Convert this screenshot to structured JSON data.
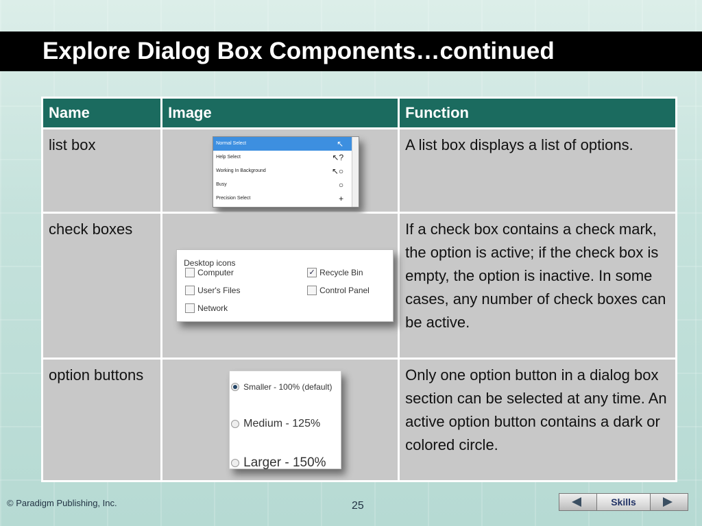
{
  "slide": {
    "title": "Explore Dialog Box Components…continued",
    "page_number": "25",
    "copyright": "© Paradigm Publishing, Inc.",
    "nav_label": "Skills"
  },
  "table": {
    "headers": [
      "Name",
      "Image",
      "Function"
    ],
    "rows": [
      {
        "name": "list box",
        "function": "A list box displays a list of options."
      },
      {
        "name": "check boxes",
        "function": "If a check box contains a check mark, the option is active; if the check box is empty, the option is inactive. In some cases, any number of check boxes can be active."
      },
      {
        "name": "option buttons",
        "function": "Only one option button in a dialog box section can be selected at any time. An active option button contains a dark or colored circle."
      }
    ]
  },
  "listbox_image": {
    "items": [
      "Normal Select",
      "Help Select",
      "Working In Background",
      "Busy",
      "Precision Select"
    ],
    "cursors": [
      "↖",
      "↖?",
      "↖○",
      "○",
      "+"
    ]
  },
  "checkbox_image": {
    "legend": "Desktop icons",
    "items": [
      {
        "label": "Computer",
        "checked": false
      },
      {
        "label": "Recycle Bin",
        "checked": true
      },
      {
        "label": "User's Files",
        "checked": false
      },
      {
        "label": "Control Panel",
        "checked": false
      },
      {
        "label": "Network",
        "checked": false
      }
    ]
  },
  "option_image": {
    "items": [
      {
        "label": "Smaller - 100% (default)",
        "selected": true
      },
      {
        "label": "Medium - 125%",
        "selected": false
      },
      {
        "label": "Larger - 150%",
        "selected": false
      }
    ]
  },
  "colors": {
    "header_bg": "#1b6b5f",
    "cell_bg": "#c8c8c8",
    "title_bar": "#000000"
  }
}
